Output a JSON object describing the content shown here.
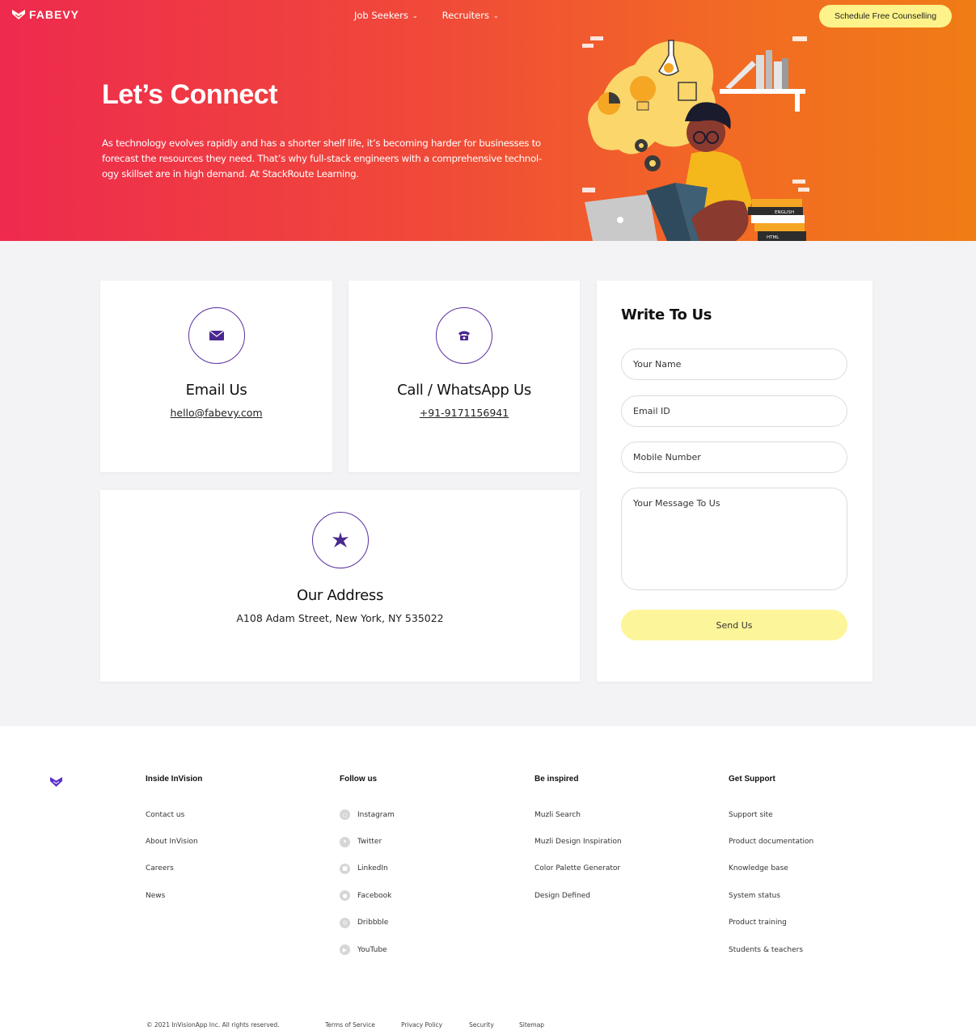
{
  "header": {
    "brand": "FABEVY",
    "nav": [
      {
        "label": "Job Seekers",
        "icon": "chevron-down-icon"
      },
      {
        "label": "Recruiters",
        "icon": "chevron-down-icon"
      }
    ],
    "cta_label": "Schedule Free Counselling"
  },
  "hero": {
    "title": "Let’s Connect",
    "description": "As technology evolves rapidly and has a shorter shelf life, it’s becoming harder for businesses to forecast the resources they need. That’s why full-stack engineers with a comprehensive technol- ogy skillset are in high demand. At StackRoute Learning.",
    "illustration_book_labels": [
      "ENGLISH",
      "HTML"
    ]
  },
  "contact": {
    "email": {
      "title": "Email Us",
      "value": "hello@fabevy.com",
      "icon": "envelope-icon"
    },
    "phone": {
      "title": "Call / WhatsApp Us",
      "value": "+91-9171156941",
      "icon": "phone-icon"
    },
    "address": {
      "title": "Our Address",
      "value": "A108 Adam Street, New York, NY 535022",
      "icon": "location-icon"
    }
  },
  "form": {
    "title": "Write To Us",
    "name_placeholder": "Your Name",
    "email_placeholder": "Email ID",
    "mobile_placeholder": "Mobile Number",
    "message_placeholder": "Your Message To Us",
    "submit_label": "Send Us"
  },
  "footer": {
    "columns": [
      {
        "heading": "Inside InVision",
        "links": [
          "Contact us",
          "About InVision",
          "Careers",
          "News"
        ]
      },
      {
        "heading": "Follow us",
        "links": [
          "Instagram",
          "Twitter",
          "LinkedIn",
          "Facebook",
          "Dribbble",
          "YouTube"
        ],
        "icons": [
          "instagram-icon",
          "twitter-icon",
          "linkedin-icon",
          "facebook-icon",
          "dribbble-icon",
          "youtube-icon"
        ]
      },
      {
        "heading": "Be inspired",
        "links": [
          "Muzli Search",
          "Muzli Design Inspiration",
          "Color Palette Generator",
          "Design Defined"
        ]
      },
      {
        "heading": "Get Support",
        "links": [
          "Support site",
          "Product documentation",
          "Knowledge base",
          "System status",
          "Product training",
          "Students & teachers"
        ]
      }
    ],
    "copyright": "© 2021 InVisionApp Inc. All rights reserved.",
    "legal_links": [
      "Terms of Service",
      "Privacy Policy",
      "Security",
      "Sitemap"
    ]
  },
  "colors": {
    "hero_start": "#ee2a4e",
    "hero_end": "#f07c16",
    "cta_yellow": "#fdf38a",
    "accent_purple": "#5b2fa0",
    "page_bg": "#f3f3f5"
  }
}
